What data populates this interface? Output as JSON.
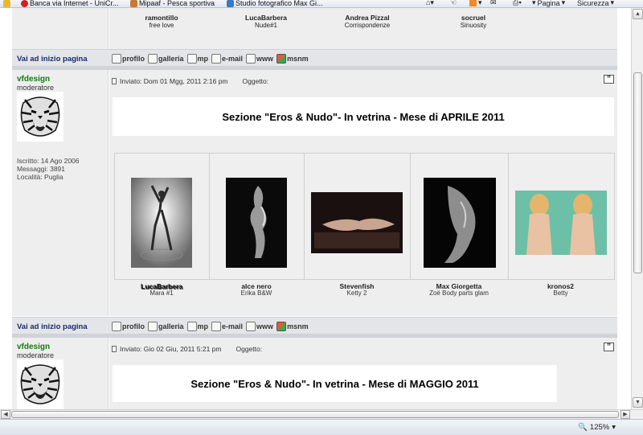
{
  "favorites": [
    {
      "label": "Banca via Internet - UniCr...",
      "color": "#d02020"
    },
    {
      "label": "Mipaaf - Pesca sportiva",
      "color": "#c87830"
    },
    {
      "label": "Studio fotografico Max Gi...",
      "color": "#3a78c8"
    }
  ],
  "toolbar": {
    "page_label": "Pagina",
    "security_label": "Sicurezza"
  },
  "top_gallery": [
    {
      "author": "ramontillo",
      "title": "free love"
    },
    {
      "author": "LucaBarbera",
      "title": "Nude#1"
    },
    {
      "author": "Andrea Pizzal",
      "title": "Corrispondenze"
    },
    {
      "author": "socruel",
      "title": "Sinuosity"
    }
  ],
  "nav": {
    "back_to_top": "Vai ad inizio pagina",
    "buttons": [
      "profilo",
      "galleria",
      "mp",
      "e-mail",
      "www",
      "msnm"
    ]
  },
  "posts": [
    {
      "user": "vfdesign",
      "role": "moderatore",
      "info": [
        "Iscritto: 14 Ago 2006",
        "Messaggi: 3891",
        "Località: Puglia"
      ],
      "sent": "Inviato: Dom 01 Mgg, 2011 2:16 pm",
      "subject_label": "Oggetto:",
      "banner": "Sezione \"Eros & Nudo\"- In vetrina - Mese di APRILE 2011"
    },
    {
      "user": "vfdesign",
      "role": "moderatore",
      "sent": "Inviato: Gio 02 Giu, 2011 5:21 pm",
      "subject_label": "Oggetto:",
      "banner": "Sezione \"Eros & Nudo\"- In vetrina - Mese di MAGGIO 2011"
    }
  ],
  "gallery": [
    {
      "author": "LucaBarbera",
      "title": "Mara #1"
    },
    {
      "author": "alce nero",
      "title": "Erika B&W"
    },
    {
      "author": "Stevenfish",
      "title": "Ketty 2"
    },
    {
      "author": "Max Giorgetta",
      "title": "Zoë Body parts glam"
    },
    {
      "author": "kronos2",
      "title": "Betty"
    }
  ],
  "status": {
    "zoom": "125%"
  }
}
